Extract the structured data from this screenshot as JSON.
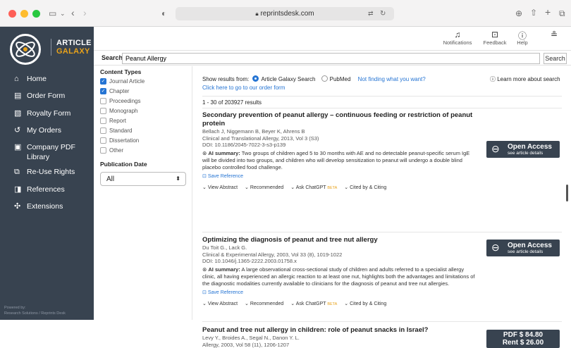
{
  "browser": {
    "url": "reprintsdesk.com"
  },
  "brand": {
    "line1": "ARTICLE",
    "line2": "GALAXY",
    "powered_by_1": "Powered by:",
    "powered_by_2": "Research Solutions / Reprints Desk"
  },
  "sidebar": {
    "items": [
      {
        "icon": "home-icon",
        "label": "Home"
      },
      {
        "icon": "form-icon",
        "label": "Order Form"
      },
      {
        "icon": "royalty-icon",
        "label": "Royalty Form"
      },
      {
        "icon": "history-icon",
        "label": "My Orders"
      },
      {
        "icon": "library-icon",
        "label": "Company PDF Library"
      },
      {
        "icon": "copy-icon",
        "label": "Re-Use Rights"
      },
      {
        "icon": "bookmark-icon",
        "label": "References"
      },
      {
        "icon": "puzzle-icon",
        "label": "Extensions"
      }
    ]
  },
  "topbar": {
    "notifications": "Notifications",
    "feedback": "Feedback",
    "help": "Help"
  },
  "search": {
    "label": "Search",
    "value": "Peanut Allergy",
    "button": "Search"
  },
  "filters": {
    "content_types_title": "Content Types",
    "content_types": [
      {
        "label": "Journal Article",
        "checked": true
      },
      {
        "label": "Chapter",
        "checked": true
      },
      {
        "label": "Proceedings",
        "checked": false
      },
      {
        "label": "Monograph",
        "checked": false
      },
      {
        "label": "Report",
        "checked": false
      },
      {
        "label": "Standard",
        "checked": false
      },
      {
        "label": "Dissertation",
        "checked": false
      },
      {
        "label": "Other",
        "checked": false
      }
    ],
    "pub_date_title": "Publication Date",
    "pub_date_value": "All"
  },
  "results_header": {
    "show_from": "Show results from:",
    "source1": "Article Galaxy Search",
    "source2": "PubMed",
    "not_finding": "Not finding what you want?",
    "order_form_link": "Click here to go to our order form",
    "learn_more": "Learn more about search",
    "count": "1 - 30 of 203927 results"
  },
  "actions": {
    "view_abstract": "View Abstract",
    "recommended": "Recommended",
    "ask": "Ask ChatGPT",
    "beta": "BETA",
    "cited": "Cited by & Citing",
    "save": "Save Reference",
    "ai_label": "AI summary:"
  },
  "results": [
    {
      "title": "Secondary prevention of peanut allergy – continuous feeding or restriction of peanut protein",
      "authors": "Bellach J, Niggemann B, Beyer K, Ahrens B",
      "journal": "Clinical and Translational Allergy, 2013, Vol 3 (S3)",
      "doi": "DOI: 10.1186/2045-7022-3-s3-p139",
      "summary": "Two groups of children aged 5 to 30 months with AE and no detectable peanut-specific serum IgE will be divided into two groups, and children who will develop sensitization to peanut will undergo a double blind placebo controlled food challenge.",
      "access_title": "Open Access",
      "access_sub": "see article details"
    },
    {
      "title": "Optimizing the diagnosis of peanut and tree nut allergy",
      "authors": "Du Toit G., Lack G.",
      "journal": "Clinical & Experimental Allergy, 2003, Vol 33 (8), 1019-1022",
      "doi": "DOI: 10.1046/j.1365-2222.2003.01758.x",
      "summary": "A large observational cross-sectional study of children and adults referred to a specialist allergy clinic, all having experienced an allergic reaction to at least one nut, highlights both the advantages and limitations of the diagnostic modalities currently available to clinicians for the diagnosis of peanut and tree nut allergies.",
      "access_title": "Open Access",
      "access_sub": "see article details"
    },
    {
      "title": "Peanut and tree nut allergy in children: role of peanut snacks in Israel?",
      "authors": "Levy Y., Broides A., Segal N., Danon Y. L.",
      "journal": "Allergy, 2003, Vol 58 (11), 1206-1207",
      "pdf_price": "PDF $ 84.80",
      "rent_price": "Rent $ 26.00"
    }
  ],
  "colors": {
    "sidebar": "#384350",
    "accent": "#2574d3",
    "logo_orange": "#e8a21a"
  }
}
